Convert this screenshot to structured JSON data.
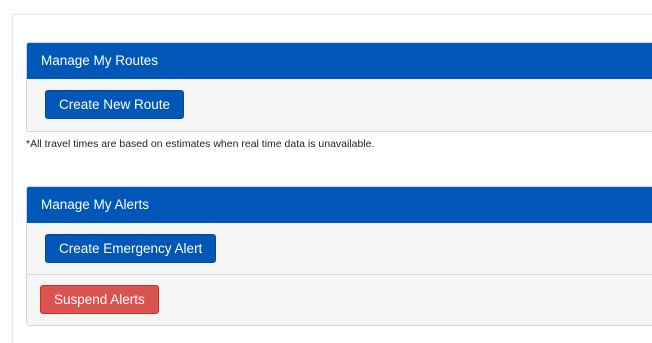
{
  "routes_panel": {
    "title": "Manage My Routes",
    "create_button": "Create New Route"
  },
  "note": "*All travel times are based on estimates when real time data is unavailable.",
  "alerts_panel": {
    "title": "Manage My Alerts",
    "create_button": "Create Emergency Alert",
    "suspend_button": "Suspend Alerts"
  },
  "colors": {
    "heading_bg": "#0057b8",
    "primary_button": "#0057b8",
    "danger_button": "#d9534f",
    "panel_body": "#f5f5f5"
  }
}
